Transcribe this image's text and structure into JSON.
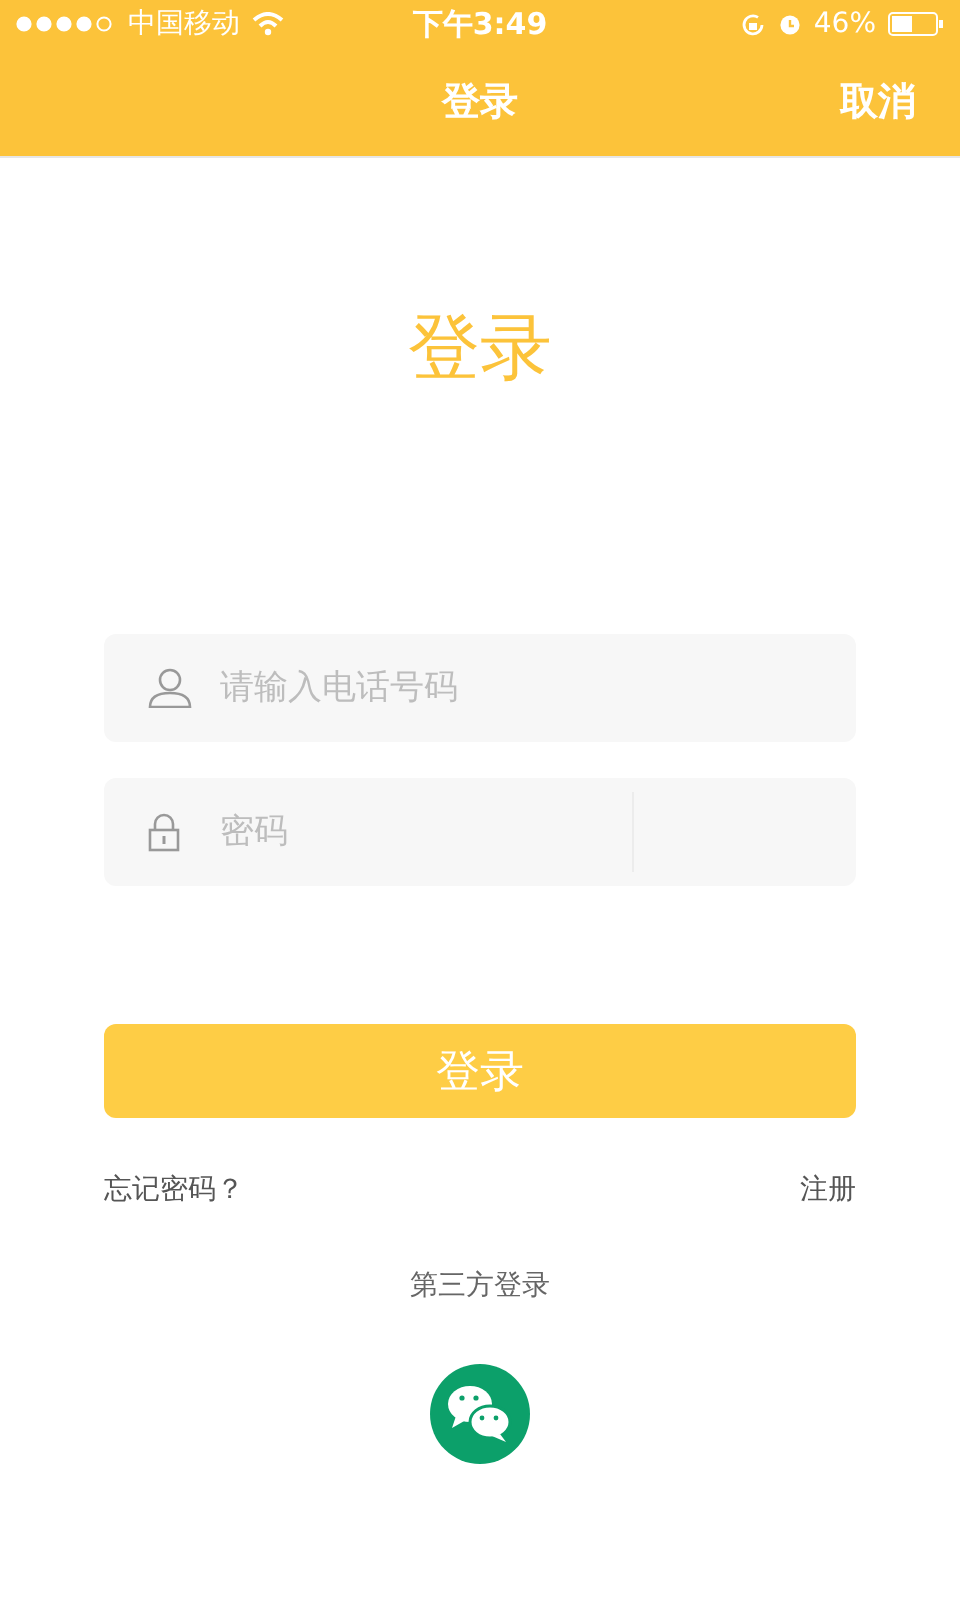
{
  "status_bar": {
    "carrier": "中国移动",
    "time": "下午3:49",
    "battery": "46%"
  },
  "nav": {
    "title": "登录",
    "cancel": "取消"
  },
  "heading": "登录",
  "fields": [
    {
      "kind": "phone",
      "placeholder": "请输入电话号码"
    },
    {
      "kind": "password",
      "placeholder": "密码"
    }
  ],
  "login_button": "登录",
  "forgot": "忘记密码？",
  "register": "注册",
  "third_party": "第三方登录"
}
